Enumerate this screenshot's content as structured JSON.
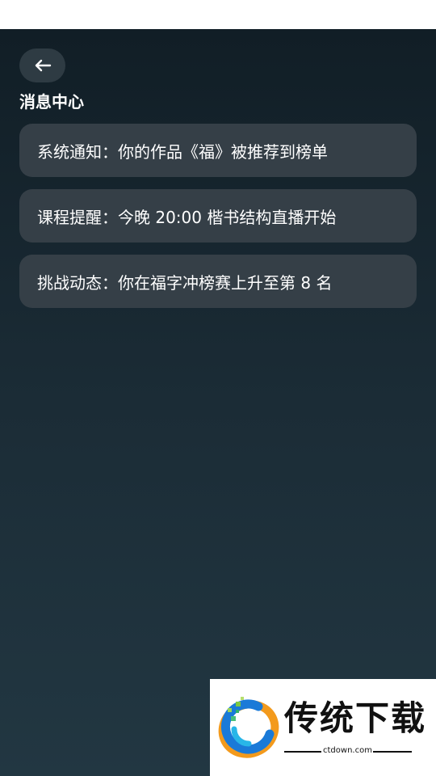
{
  "header": {
    "back_icon": "arrow-left-icon",
    "title": "消息中心"
  },
  "messages": [
    {
      "text": "系统通知：你的作品《福》被推荐到榜单"
    },
    {
      "text": "课程提醒：今晚 20:00 楷书结构直播开始"
    },
    {
      "text": "挑战动态：你在福字冲榜赛上升至第 8 名"
    }
  ],
  "watermark": {
    "brand": "传统下载",
    "url": "ctdown.com"
  },
  "colors": {
    "background_top": "#111e26",
    "background_bottom": "#223742",
    "card": "#353f47",
    "back_button": "#2e3b43",
    "text": "#ffffff"
  }
}
